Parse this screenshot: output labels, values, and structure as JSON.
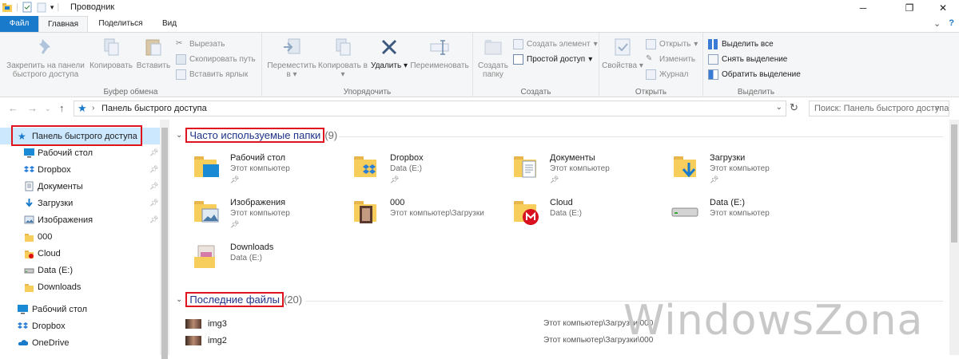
{
  "window": {
    "title": "Проводник"
  },
  "tabs": {
    "file": "Файл",
    "home": "Главная",
    "share": "Поделиться",
    "view": "Вид"
  },
  "ribbon": {
    "clipboard": {
      "label": "Буфер обмена",
      "pin": "Закрепить на панели быстрого доступа",
      "copy": "Копировать",
      "paste": "Вставить",
      "cut": "Вырезать",
      "copy_path": "Скопировать путь",
      "paste_shortcut": "Вставить ярлык"
    },
    "organize": {
      "label": "Упорядочить",
      "move": "Переместить в",
      "copyto": "Копировать в",
      "delete": "Удалить",
      "rename": "Переименовать"
    },
    "new": {
      "label": "Создать",
      "new_folder": "Создать папку",
      "new_item": "Создать элемент",
      "easy_access": "Простой доступ"
    },
    "open": {
      "label": "Открыть",
      "properties": "Свойства",
      "open": "Открыть",
      "edit": "Изменить",
      "history": "Журнал"
    },
    "select": {
      "label": "Выделить",
      "select_all": "Выделить все",
      "select_none": "Снять выделение",
      "invert": "Обратить выделение"
    }
  },
  "address": {
    "path": "Панель быстрого доступа",
    "search_placeholder": "Поиск: Панель быстрого доступа"
  },
  "nav": {
    "quick_access": "Панель быстрого доступа",
    "items": [
      {
        "label": "Рабочий стол",
        "icon": "desktop-icon",
        "pinned": true
      },
      {
        "label": "Dropbox",
        "icon": "dropbox-icon",
        "pinned": true
      },
      {
        "label": "Документы",
        "icon": "documents-icon",
        "pinned": true
      },
      {
        "label": "Загрузки",
        "icon": "downloads-icon",
        "pinned": true
      },
      {
        "label": "Изображения",
        "icon": "pictures-icon",
        "pinned": true
      },
      {
        "label": "000",
        "icon": "folder-icon",
        "pinned": false
      },
      {
        "label": "Cloud",
        "icon": "cloud-folder-icon",
        "pinned": false
      },
      {
        "label": "Data (E:)",
        "icon": "drive-icon",
        "pinned": false
      },
      {
        "label": "Downloads",
        "icon": "folder-icon",
        "pinned": false
      }
    ],
    "root_items": [
      {
        "label": "Рабочий стол",
        "icon": "desktop-icon"
      },
      {
        "label": "Dropbox",
        "icon": "dropbox-icon"
      },
      {
        "label": "OneDrive",
        "icon": "onedrive-icon"
      }
    ]
  },
  "frequent": {
    "title": "Часто используемые папки",
    "count": "(9)",
    "folders": [
      {
        "name": "Рабочий стол",
        "sub": "Этот компьютер",
        "pinned": true,
        "icon": "desktop-folder-icon"
      },
      {
        "name": "Dropbox",
        "sub": "Data (E:)",
        "pinned": true,
        "icon": "dropbox-folder-icon"
      },
      {
        "name": "Документы",
        "sub": "Этот компьютер",
        "pinned": true,
        "icon": "documents-folder-icon"
      },
      {
        "name": "Загрузки",
        "sub": "Этот компьютер",
        "pinned": true,
        "icon": "downloads-folder-icon"
      },
      {
        "name": "Изображения",
        "sub": "Этот компьютер",
        "pinned": true,
        "icon": "pictures-folder-icon"
      },
      {
        "name": "000",
        "sub": "Этот компьютер\\Загрузки",
        "pinned": false,
        "icon": "photo-folder-icon"
      },
      {
        "name": "Cloud",
        "sub": "Data (E:)",
        "pinned": false,
        "icon": "cloud-folder-icon"
      },
      {
        "name": "Data (E:)",
        "sub": "Этот компьютер",
        "pinned": false,
        "icon": "drive-icon"
      },
      {
        "name": "Downloads",
        "sub": "Data (E:)",
        "pinned": false,
        "icon": "image-folder-icon"
      }
    ]
  },
  "recent": {
    "title": "Последние файлы",
    "count": "(20)",
    "files": [
      {
        "name": "img3",
        "path": "Этот компьютер\\Загрузки\\000"
      },
      {
        "name": "img2",
        "path": "Этот компьютер\\Загрузки\\000"
      }
    ]
  },
  "watermark": "WindowsZona",
  "colors": {
    "accent": "#1979ca",
    "highlight": "#e0141e",
    "section_title": "#1e3287"
  }
}
